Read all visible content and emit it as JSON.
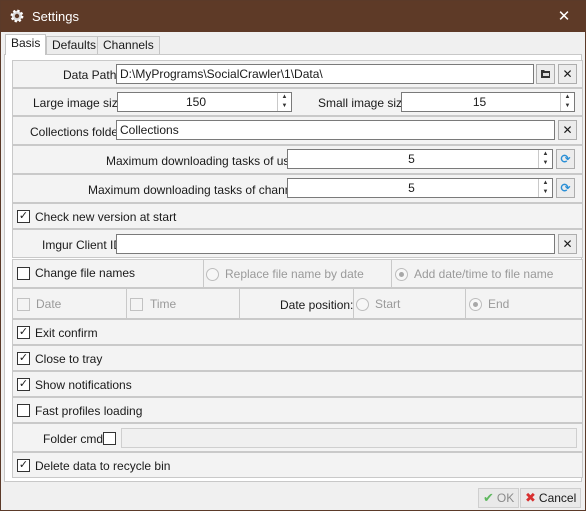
{
  "window": {
    "title": "Settings",
    "close_glyph": "✕"
  },
  "tabs": [
    {
      "label": "Basis",
      "active": true
    },
    {
      "label": "Defaults",
      "active": false
    },
    {
      "label": "Channels",
      "active": false
    }
  ],
  "data_path": {
    "label": "Data Path",
    "value": "D:\\MyPrograms\\SocialCrawler\\1\\Data\\"
  },
  "image_sizes": {
    "large_label": "Large image size",
    "large_value": "150",
    "small_label": "Small image size",
    "small_value": "15"
  },
  "collections": {
    "label": "Collections folder",
    "value": "Collections"
  },
  "tasks": {
    "users_label": "Maximum downloading tasks of users",
    "users_value": "5",
    "channels_label": "Maximum downloading tasks of channels",
    "channels_value": "5"
  },
  "check_version": {
    "label": "Check new version at start",
    "checked": true
  },
  "imgur": {
    "label": "Imgur Client ID",
    "value": ""
  },
  "file_names": {
    "change_label": "Change file names",
    "change_checked": false,
    "replace_label": "Replace file name by date",
    "add_label": "Add date/time to file name",
    "date_label": "Date",
    "time_label": "Time",
    "position_label": "Date position:",
    "start_label": "Start",
    "end_label": "End"
  },
  "options": [
    {
      "label": "Exit confirm",
      "checked": true
    },
    {
      "label": "Close to tray",
      "checked": true
    },
    {
      "label": "Show notifications",
      "checked": true
    },
    {
      "label": "Fast profiles loading",
      "checked": false
    }
  ],
  "folder_cmd": {
    "label": "Folder cmd",
    "checked": false,
    "value": ""
  },
  "recycle": {
    "label": "Delete data to recycle bin",
    "checked": true
  },
  "footer": {
    "ok_label": "OK",
    "cancel_label": "Cancel"
  },
  "colors": {
    "titlebar": "#5e3a27",
    "ok_icon": "#5fb85f",
    "cancel_icon": "#d83030",
    "refresh_icon": "#2a8fd6"
  }
}
